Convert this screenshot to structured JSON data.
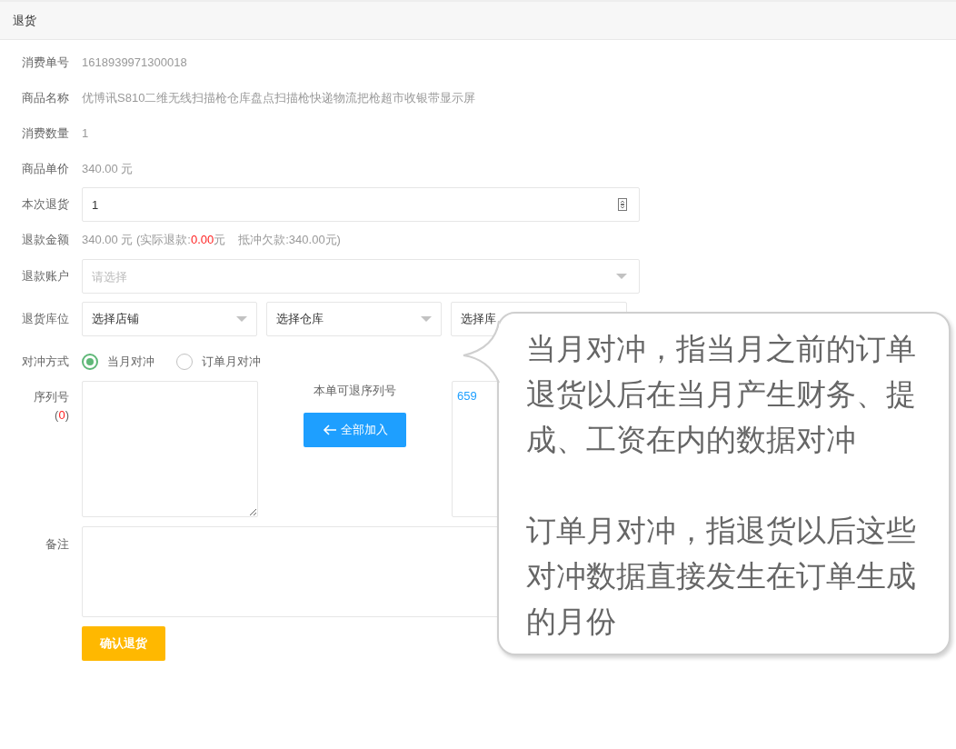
{
  "panel": {
    "title": "退货"
  },
  "fields": [
    {
      "label": "消费单号",
      "kind": "text",
      "value": "1618939971300018"
    },
    {
      "label": "商品名称",
      "kind": "text",
      "value": "优博讯S810二维无线扫描枪仓库盘点扫描枪快递物流把枪超市收银带显示屏"
    },
    {
      "label": "消费数量",
      "kind": "text",
      "value": "1"
    },
    {
      "label": "商品单价",
      "kind": "text",
      "value": "340.00 元"
    },
    {
      "label": "本次退货",
      "kind": "number",
      "value": "1"
    },
    {
      "label": "退款金额",
      "kind": "amount",
      "value": "340.00 元 (实际退款:",
      "refund": "0.00",
      "refund_unit": "元",
      "offset": "抵冲欠款:340.00元)"
    },
    {
      "label": "退款账户",
      "kind": "select",
      "placeholder": "请选择"
    },
    {
      "label": "退货库位",
      "kind": "selects",
      "selects": [
        {
          "value": "选择店铺",
          "arrow": true
        },
        {
          "value": "选择仓库",
          "arrow": true
        },
        {
          "value": "选择库"
        }
      ]
    },
    {
      "label": "对冲方式",
      "kind": "radio",
      "options": [
        {
          "label": "当月对冲",
          "selected": true
        },
        {
          "label": "订单月对冲",
          "selected": false
        }
      ]
    },
    {
      "label": "序列号",
      "kind": "serials",
      "count_open": "(",
      "count": "0",
      "count_close": ")",
      "available_label": "本单可退序列号",
      "button": "全部加入",
      "available": [
        "659"
      ]
    },
    {
      "label": "备注",
      "kind": "textarea"
    }
  ],
  "submit": "确认退货",
  "callout": {
    "paragraphs": [
      "当月对冲，指当月之前的订单退货以后在当月产生财务、提成、工资在内的数据对冲",
      "订单月对冲，指退货以后这些对冲数据直接发生在订单生成的月份"
    ]
  }
}
